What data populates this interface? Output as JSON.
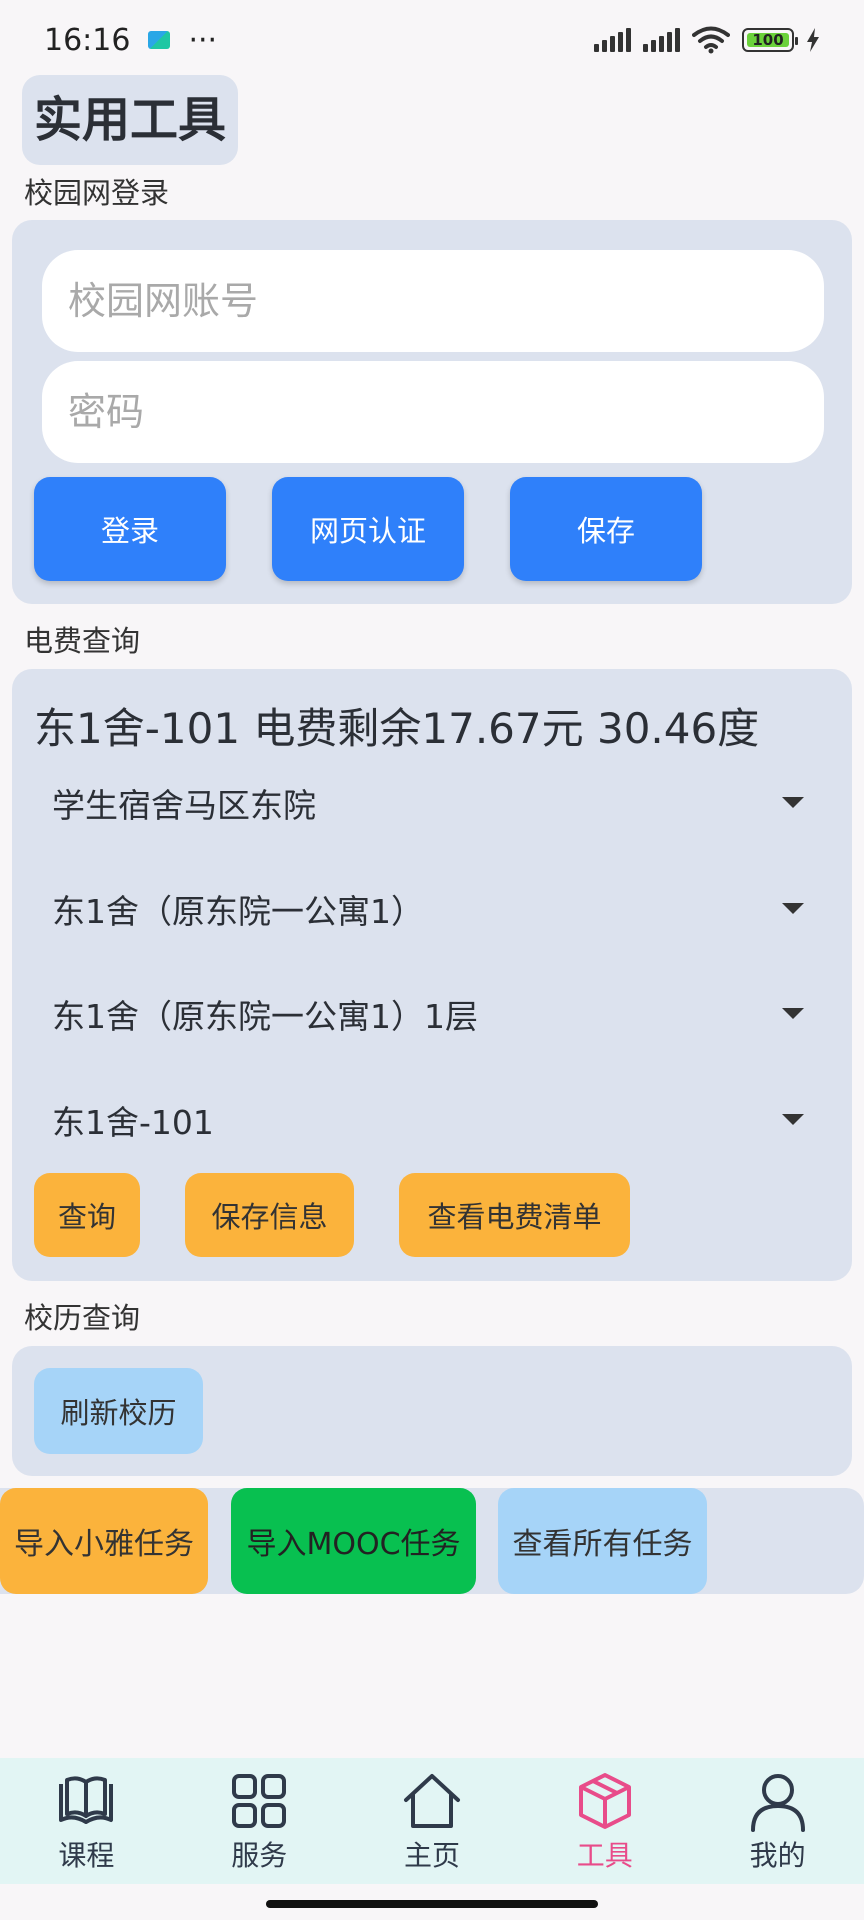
{
  "status_bar": {
    "time": "16:16",
    "more": "···",
    "battery_level": "100"
  },
  "page": {
    "title": "实用工具"
  },
  "campus_login": {
    "section_label": "校园网登录",
    "account_placeholder": "校园网账号",
    "password_placeholder": "密码",
    "login_label": "登录",
    "web_auth_label": "网页认证",
    "save_label": "保存"
  },
  "electricity": {
    "section_label": "电费查询",
    "status_text": "东1舍-101 电费剩余17.67元 30.46度",
    "selects": [
      "学生宿舍马区东院",
      "东1舍（原东院一公寓1）",
      "东1舍（原东院一公寓1）1层",
      "东1舍-101"
    ],
    "query_label": "查询",
    "save_info_label": "保存信息",
    "view_bill_label": "查看电费清单"
  },
  "calendar": {
    "section_label": "校历查询",
    "refresh_label": "刷新校历"
  },
  "tasks": {
    "import_xiaoya_label": "导入小雅任务",
    "import_mooc_label": "导入MOOC任务",
    "view_all_label": "查看所有任务"
  },
  "bottom_nav": {
    "items": [
      {
        "label": "课程",
        "icon": "book-icon"
      },
      {
        "label": "服务",
        "icon": "grid-icon"
      },
      {
        "label": "主页",
        "icon": "home-icon"
      },
      {
        "label": "工具",
        "icon": "cube-icon"
      },
      {
        "label": "我的",
        "icon": "person-icon"
      }
    ],
    "active_index": 3,
    "active_color": "#e84c8a"
  },
  "colors": {
    "primary_button": "#2f80fa",
    "accent_orange": "#fbb33c",
    "light_blue": "#a6d4f8",
    "green": "#08c050",
    "card_bg": "#dce2ee"
  }
}
